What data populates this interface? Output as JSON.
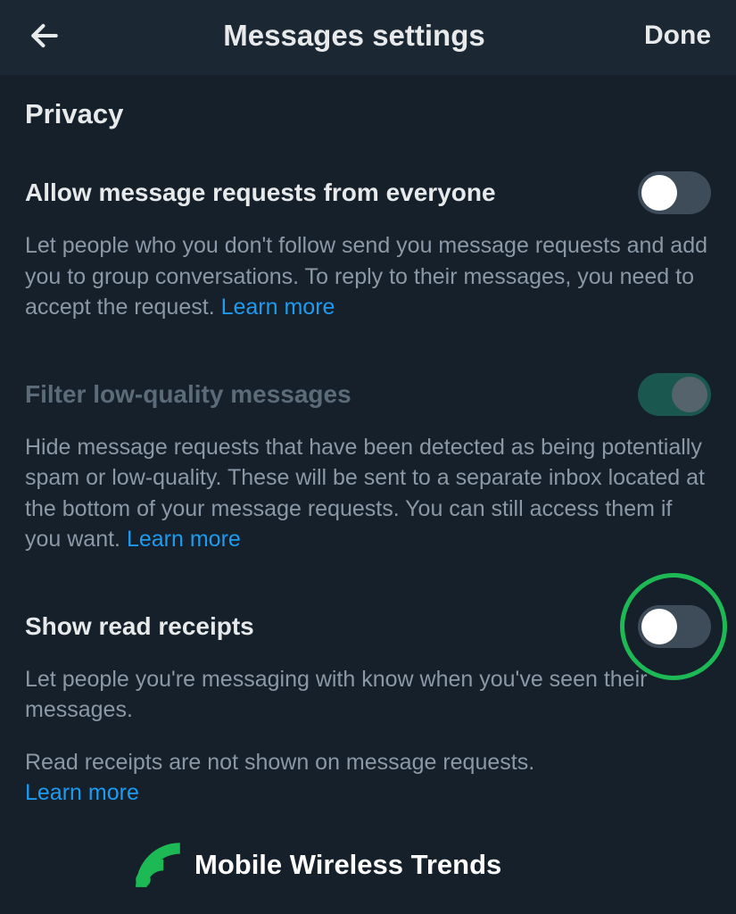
{
  "header": {
    "title": "Messages settings",
    "done": "Done"
  },
  "section": {
    "title": "Privacy"
  },
  "settings": {
    "allow": {
      "title": "Allow message requests from everyone",
      "desc": "Let people who you don't follow send you message requests and add you to group conversations. To reply to their messages, you need to accept the request. ",
      "learn": "Learn more"
    },
    "filter": {
      "title": "Filter low-quality messages",
      "desc": "Hide message requests that have been detected as being potentially spam or low-quality. These will be sent to a separate inbox located at the bottom of your message requests. You can still access them if you want. ",
      "learn": "Learn more"
    },
    "receipts": {
      "title": "Show read receipts",
      "desc": "Let people you're messaging with know when you've seen their messages.",
      "note": "Read receipts are not shown on message requests. ",
      "learn": "Learn more"
    }
  },
  "watermark": {
    "text": "Mobile Wireless Trends"
  }
}
